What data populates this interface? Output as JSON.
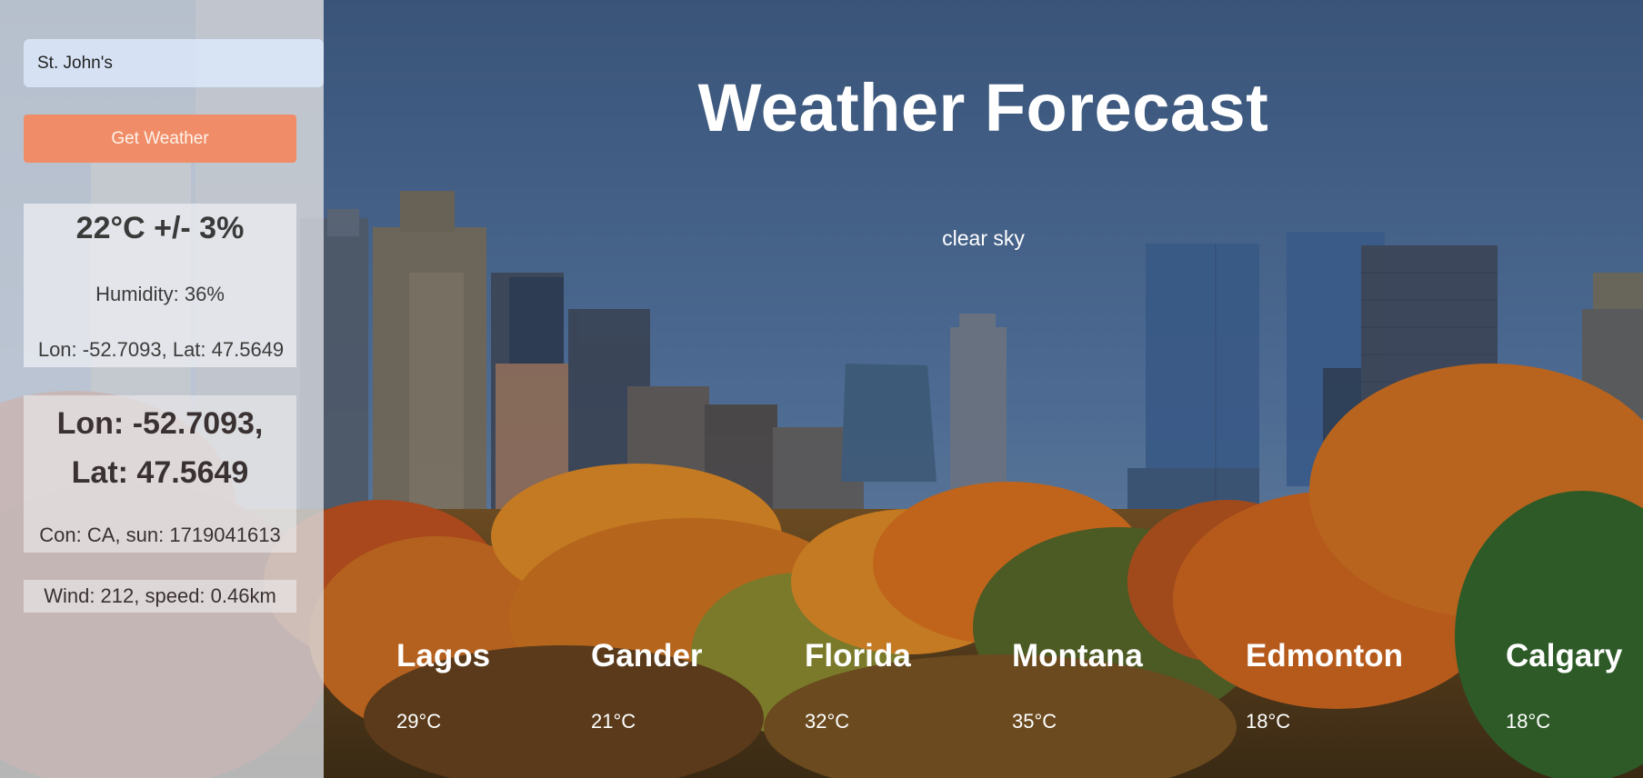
{
  "search": {
    "value": "St. John's",
    "button_label": "Get Weather"
  },
  "current": {
    "temperature": "22°C +/- 3%",
    "humidity": "Humidity: 36%",
    "coordinates": "Lon: -52.7093, Lat: 47.5649",
    "coordinates_big_line1": "Lon: -52.7093,",
    "coordinates_big_line2": "Lat: 47.5649",
    "country_sunrise": "Con: CA, sun: 1719041613",
    "wind": "Wind: 212, speed: 0.46km"
  },
  "header": {
    "title": "Weather Forecast",
    "description": "clear sky"
  },
  "cities": [
    {
      "name": "Lagos",
      "temp": "29°C"
    },
    {
      "name": "Gander",
      "temp": "21°C"
    },
    {
      "name": "Florida",
      "temp": "32°C"
    },
    {
      "name": "Montana",
      "temp": "35°C"
    },
    {
      "name": "Edmonton",
      "temp": "18°C"
    },
    {
      "name": "Calgary",
      "temp": "18°C"
    }
  ],
  "colors": {
    "button": "#f08d68",
    "sky": "#3c5a80",
    "foliage": "#b8641e"
  }
}
